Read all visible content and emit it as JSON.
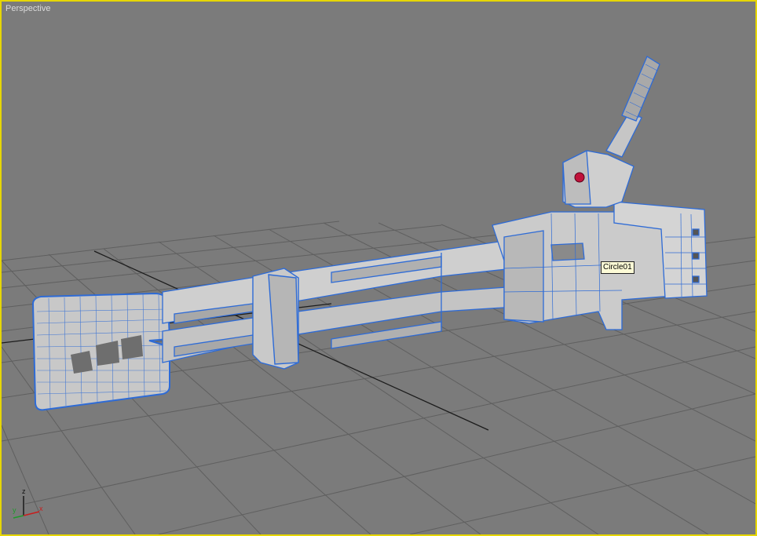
{
  "viewport": {
    "label": "Perspective",
    "active_border_color": "#e6d600",
    "background_color": "#7b7b7b"
  },
  "scene": {
    "selected_object_color": "#2e6bd6",
    "object_face_color": "#c8c8c8",
    "hover_tooltip": "Circle01",
    "marker_color": "#c0123a"
  },
  "axis_gizmo": {
    "z_label": "z",
    "y_label": "y",
    "x_label": "x"
  }
}
